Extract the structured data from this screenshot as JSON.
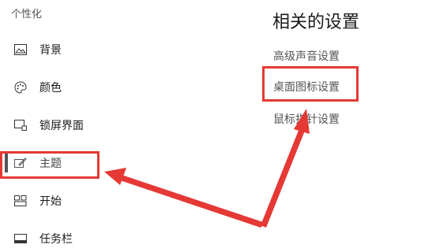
{
  "sidebar": {
    "section_title": "个性化",
    "items": [
      {
        "label": "背景",
        "icon": "picture-icon"
      },
      {
        "label": "颜色",
        "icon": "palette-icon"
      },
      {
        "label": "锁屏界面",
        "icon": "lock-screen-icon"
      },
      {
        "label": "主题",
        "icon": "theme-brush-icon",
        "active": true
      },
      {
        "label": "开始",
        "icon": "start-grid-icon"
      },
      {
        "label": "任务栏",
        "icon": "taskbar-icon"
      }
    ]
  },
  "related": {
    "title": "相关的设置",
    "links": [
      "高级声音设置",
      "桌面图标设置",
      "鼠标指针设置"
    ]
  },
  "annotation": {
    "color": "#e53935"
  }
}
